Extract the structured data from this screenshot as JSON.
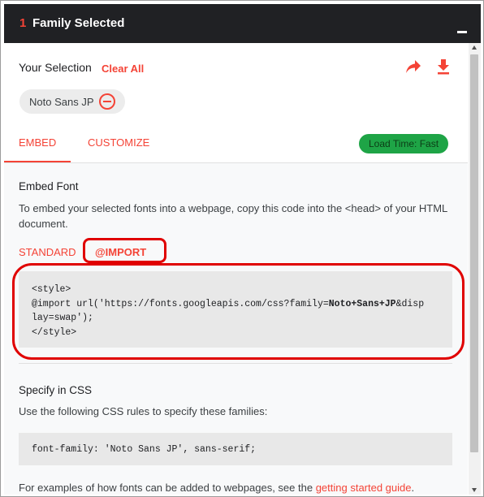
{
  "header": {
    "count": "1",
    "title": "Family Selected"
  },
  "selection": {
    "label": "Your Selection",
    "clear_all": "Clear All",
    "chip_label": "Noto Sans JP"
  },
  "tabs": [
    {
      "label": "EMBED",
      "active": true
    },
    {
      "label": "CUSTOMIZE",
      "active": false
    }
  ],
  "load_time_badge": "Load Time: Fast",
  "embed": {
    "title": "Embed Font",
    "description": "To embed your selected fonts into a webpage, copy this code into the <head> of your HTML document.",
    "subtabs": [
      {
        "label": "STANDARD",
        "active": false
      },
      {
        "label": "@IMPORT",
        "active": true
      }
    ],
    "code_line1": "<style>",
    "code_line2_pre": "@import url('https://fonts.googleapis.com/css?family=",
    "code_line2_bold": "Noto+Sans+JP",
    "code_line2_post": "&disp",
    "code_line3": "lay=swap');",
    "code_line4": "</style>"
  },
  "css": {
    "title": "Specify in CSS",
    "description": "Use the following CSS rules to specify these families:",
    "code": "font-family: 'Noto Sans JP', sans-serif;"
  },
  "footer": {
    "text": "For examples of how fonts can be added to webpages, see the ",
    "link": "getting started guide",
    "suffix": "."
  },
  "colors": {
    "accent": "#f44336",
    "header_bg": "#202124",
    "badge_bg": "#1ea446",
    "annotation_red": "#e00000"
  },
  "icons": [
    "share-icon",
    "download-icon",
    "remove-circle-icon",
    "minimize-icon"
  ]
}
